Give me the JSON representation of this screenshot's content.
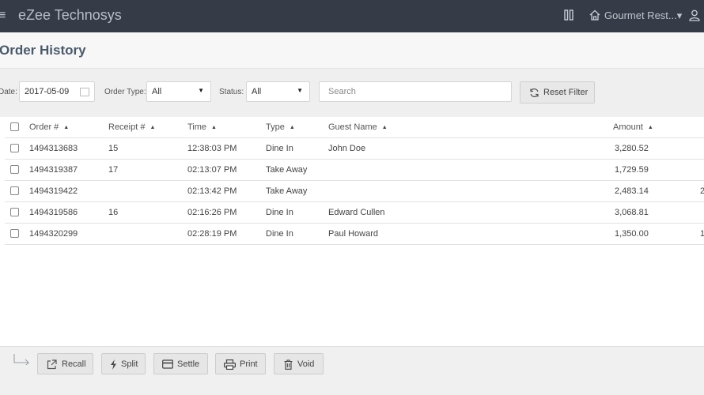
{
  "header": {
    "brand": "eZee Technosys",
    "outlet": "Gourmet Rest...▾"
  },
  "page": {
    "title": "Order History"
  },
  "filters": {
    "date_label": "Date:",
    "date_value": "2017-05-09",
    "order_type_label": "Order Type:",
    "order_type_value": "All",
    "status_label": "Status:",
    "status_value": "All",
    "search_placeholder": "Search",
    "reset_label": "Reset Filter"
  },
  "table": {
    "columns": [
      "Order #",
      "Receipt #",
      "Time",
      "Type",
      "Guest Name",
      "Amount"
    ],
    "rows": [
      {
        "order": "1494313683",
        "receipt": "15",
        "time": "12:38:03 PM",
        "type": "Dine In",
        "guest": "John Doe",
        "amount": "3,280.52",
        "extra": ""
      },
      {
        "order": "1494319387",
        "receipt": "17",
        "time": "02:13:07 PM",
        "type": "Take Away",
        "guest": "",
        "amount": "1,729.59",
        "extra": ""
      },
      {
        "order": "1494319422",
        "receipt": "",
        "time": "02:13:42 PM",
        "type": "Take Away",
        "guest": "",
        "amount": "2,483.14",
        "extra": "2"
      },
      {
        "order": "1494319586",
        "receipt": "16",
        "time": "02:16:26 PM",
        "type": "Dine In",
        "guest": "Edward Cullen",
        "amount": "3,068.81",
        "extra": ""
      },
      {
        "order": "1494320299",
        "receipt": "",
        "time": "02:28:19 PM",
        "type": "Dine In",
        "guest": "Paul Howard",
        "amount": "1,350.00",
        "extra": "1"
      }
    ]
  },
  "actions": {
    "recall": "Recall",
    "split": "Split",
    "settle": "Settle",
    "print": "Print",
    "void": "Void"
  }
}
